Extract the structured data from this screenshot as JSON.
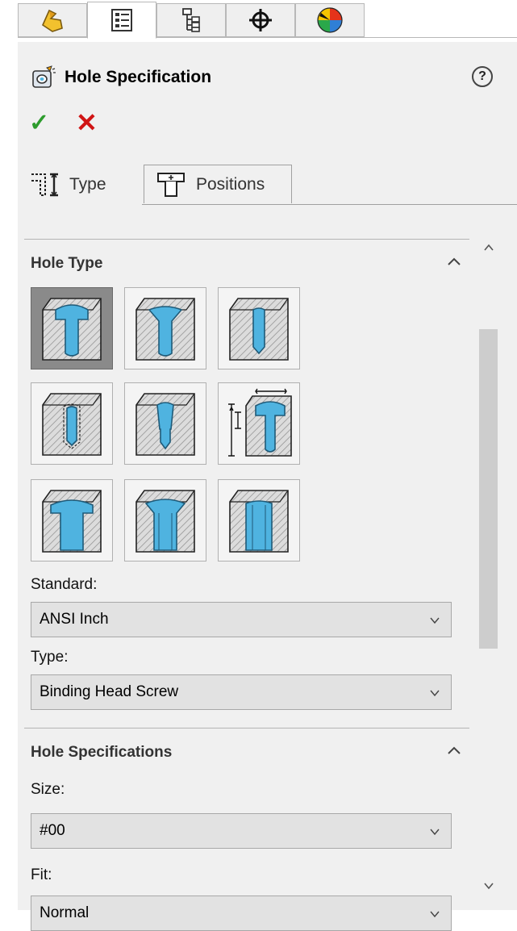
{
  "top_tabs": [
    {
      "name": "feature-manager-tab-icon"
    },
    {
      "name": "property-manager-tab-icon"
    },
    {
      "name": "configuration-manager-tab-icon"
    },
    {
      "name": "dimxpert-manager-tab-icon"
    },
    {
      "name": "display-manager-tab-icon"
    }
  ],
  "header": {
    "title": "Hole Specification",
    "help": "?"
  },
  "actions": {
    "ok": "✓",
    "cancel": "✕"
  },
  "subtabs": [
    {
      "label": "Type"
    },
    {
      "label": "Positions"
    }
  ],
  "hole_type": {
    "title": "Hole Type",
    "options": [
      {
        "name": "counterbore",
        "selected": true
      },
      {
        "name": "countersink",
        "selected": false
      },
      {
        "name": "hole",
        "selected": false
      },
      {
        "name": "straight-tap",
        "selected": false
      },
      {
        "name": "tapered-tap",
        "selected": false
      },
      {
        "name": "legacy-hole",
        "selected": false
      },
      {
        "name": "counterbore-slot",
        "selected": false
      },
      {
        "name": "countersink-slot",
        "selected": false
      },
      {
        "name": "slot",
        "selected": false
      }
    ]
  },
  "standard": {
    "label": "Standard:",
    "value": "ANSI Inch"
  },
  "type": {
    "label": "Type:",
    "value": "Binding Head Screw"
  },
  "hole_specs": {
    "title": "Hole Specifications"
  },
  "size": {
    "label": "Size:",
    "value": "#00"
  },
  "fit": {
    "label": "Fit:",
    "value": "Normal"
  },
  "colors": {
    "accent": "#4fb3e0",
    "panel": "#f0f0f0",
    "ok": "#2d9c2d",
    "cancel": "#d01414"
  }
}
